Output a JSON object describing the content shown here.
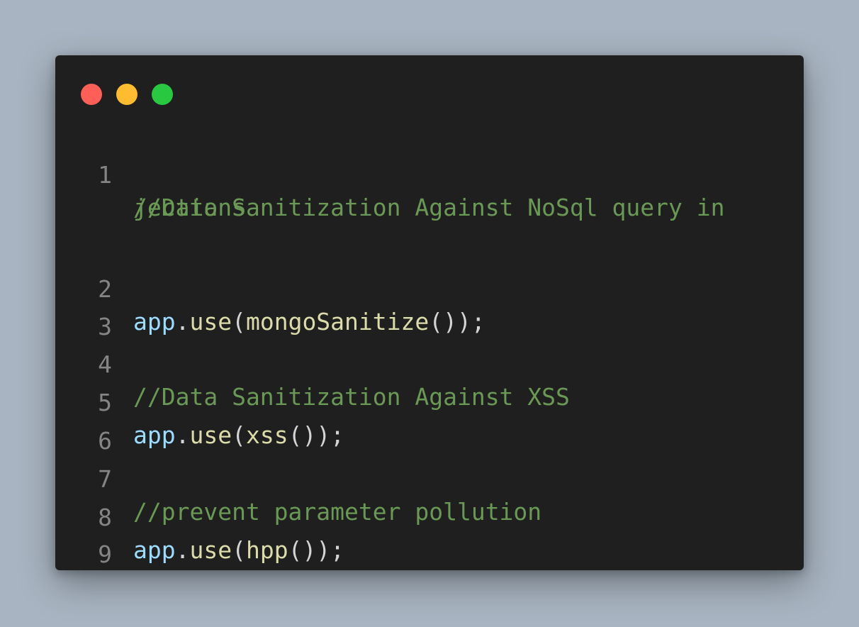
{
  "colors": {
    "background": "#a8b4c1",
    "window": "#1f1f1f",
    "dot_close": "#ff5f57",
    "dot_minimize": "#febc2e",
    "dot_maximize": "#28c840",
    "comment": "#6a9955",
    "identifier": "#9cdcfe",
    "function": "#dcdcaa",
    "punctuation": "#d4d4d4",
    "line_number": "#858585"
  },
  "code": {
    "lines": [
      {
        "num": "1",
        "comment_a": "//Data Sanitization Against NoSql query in",
        "comment_b": "jections"
      },
      {
        "num": "2",
        "obj": "app",
        "dot": ".",
        "method": "use",
        "open": "(",
        "arg": "mongoSanitize",
        "close": "());"
      },
      {
        "num": "3"
      },
      {
        "num": "4",
        "comment": "//Data Sanitization Against XSS"
      },
      {
        "num": "5",
        "obj": "app",
        "dot": ".",
        "method": "use",
        "open": "(",
        "arg": "xss",
        "close": "());"
      },
      {
        "num": "6"
      },
      {
        "num": "7",
        "comment": "//prevent parameter pollution"
      },
      {
        "num": "8",
        "obj": "app",
        "dot": ".",
        "method": "use",
        "open": "(",
        "arg": "hpp",
        "close": "());"
      },
      {
        "num": "9"
      }
    ]
  }
}
